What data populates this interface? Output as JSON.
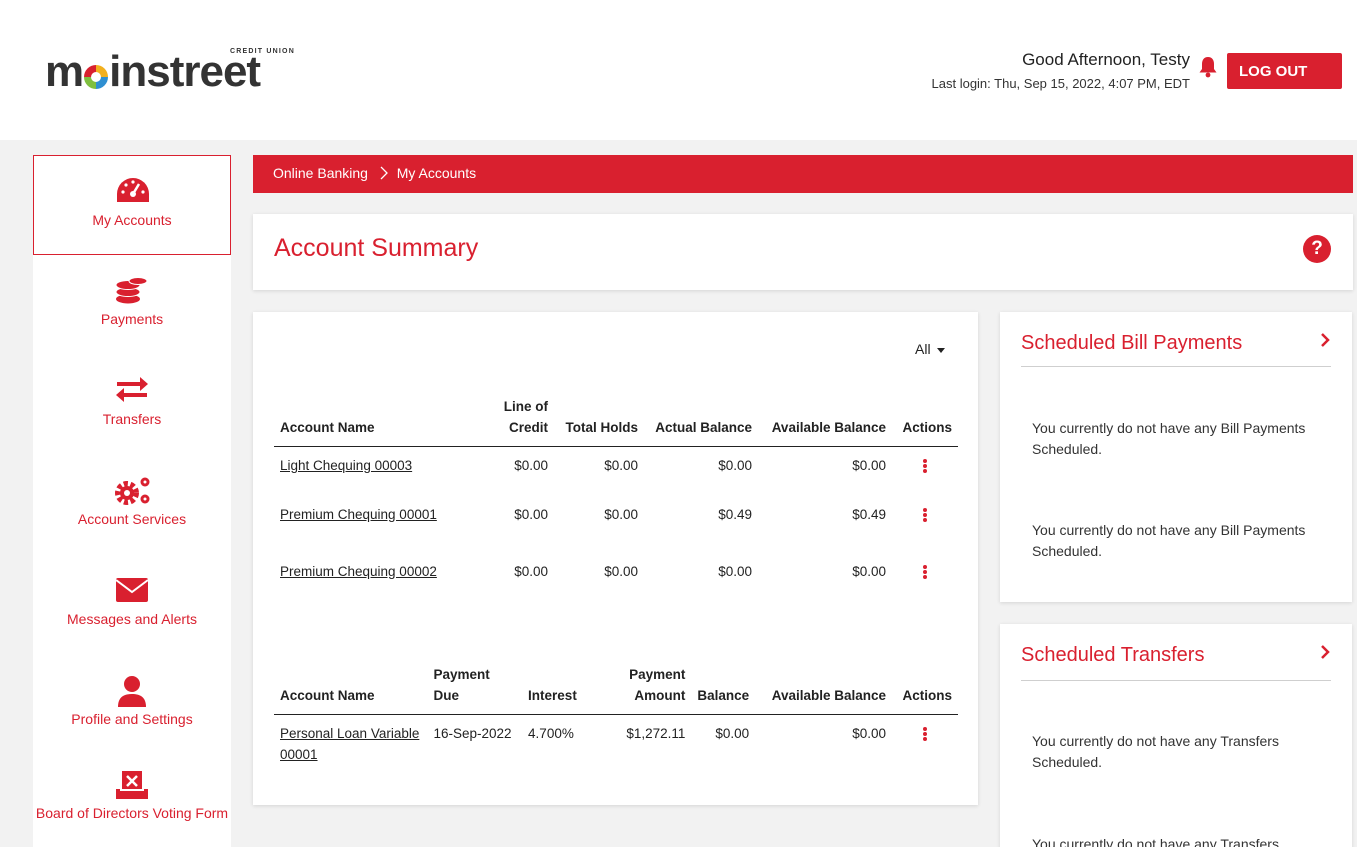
{
  "header": {
    "logo_small": "CREDIT UNION",
    "logo_text_pre": "m",
    "logo_text_post": "instreet",
    "greeting": "Good Afternoon, Testy",
    "last_login": "Last login: Thu, Sep 15, 2022, 4:07 PM, EDT",
    "logout_label": "LOG OUT"
  },
  "sidebar": {
    "items": [
      {
        "label": "My Accounts",
        "icon": "gauge-icon",
        "active": true
      },
      {
        "label": "Payments",
        "icon": "coins-icon"
      },
      {
        "label": "Transfers",
        "icon": "arrows-exchange-icon"
      },
      {
        "label": "Account Services",
        "icon": "gears-icon"
      },
      {
        "label": "Messages and Alerts",
        "icon": "envelope-icon"
      },
      {
        "label": "Profile and Settings",
        "icon": "user-icon"
      },
      {
        "label": "Board of Directors Voting Form",
        "icon": "ballot-box-icon"
      }
    ]
  },
  "breadcrumb": {
    "root": "Online Banking",
    "current": "My Accounts"
  },
  "summary": {
    "title": "Account Summary",
    "help": "?"
  },
  "accounts": {
    "filter": "All",
    "deposit_headers": [
      "Account Name",
      "Line of Credit",
      "Total Holds",
      "Actual Balance",
      "Available Balance",
      "Actions"
    ],
    "deposit_rows": [
      {
        "name": "Light Chequing 00003",
        "loc": "$0.00",
        "holds": "$0.00",
        "actual": "$0.00",
        "available": "$0.00"
      },
      {
        "name": "Premium Chequing 00001",
        "loc": "$0.00",
        "holds": "$0.00",
        "actual": "$0.49",
        "available": "$0.49"
      },
      {
        "name": "Premium Chequing 00002",
        "loc": "$0.00",
        "holds": "$0.00",
        "actual": "$0.00",
        "available": "$0.00"
      }
    ],
    "loan_headers": [
      "Account Name",
      "Payment Due",
      "Interest",
      "Payment Amount",
      "Balance",
      "Available Balance",
      "Actions"
    ],
    "loan_rows": [
      {
        "name": "Personal Loan Variable 00001",
        "due": "16-Sep-2022",
        "interest": "4.700%",
        "payment": "$1,272.11",
        "balance": "$0.00",
        "available": "$0.00"
      }
    ]
  },
  "bill_payments": {
    "title": "Scheduled Bill Payments",
    "messages": [
      "You currently do not have any Bill Payments Scheduled.",
      "You currently do not have any Bill Payments Scheduled."
    ]
  },
  "transfers": {
    "title": "Scheduled Transfers",
    "messages": [
      "You currently do not have any Transfers Scheduled.",
      "You currently do not have any Transfers Scheduled."
    ]
  },
  "colors": {
    "accent": "#d9202f",
    "background": "#f2f2f2"
  }
}
